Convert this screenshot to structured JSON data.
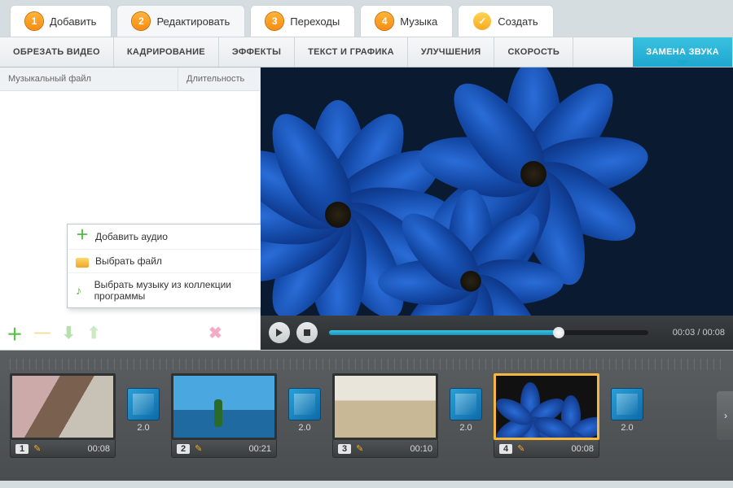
{
  "wizard": {
    "steps": [
      {
        "num": "1",
        "label": "Добавить"
      },
      {
        "num": "2",
        "label": "Редактировать"
      },
      {
        "num": "3",
        "label": "Переходы"
      },
      {
        "num": "4",
        "label": "Музыка"
      },
      {
        "num": "✓",
        "label": "Создать"
      }
    ],
    "active_index": 1
  },
  "subtabs": {
    "items": [
      "ОБРЕЗАТЬ ВИДЕО",
      "КАДРИРОВАНИЕ",
      "ЭФФЕКТЫ",
      "ТЕКСТ И ГРАФИКА",
      "УЛУЧШЕНИЯ",
      "СКОРОСТЬ",
      "ЗАМЕНА ЗВУКА"
    ],
    "active_index": 6
  },
  "left_panel": {
    "col_file": "Музыкальный файл",
    "col_duration": "Длительность"
  },
  "dropdown": {
    "header": "Добавить аудио",
    "opt_file": "Выбрать файл",
    "opt_library": "Выбрать музыку из коллекции программы"
  },
  "player": {
    "current": "00:03",
    "sep": " / ",
    "total": "00:08",
    "progress_pct": 72
  },
  "timeline": {
    "clips": [
      {
        "idx": "1",
        "dur": "00:08",
        "trans": "2.0"
      },
      {
        "idx": "2",
        "dur": "00:21",
        "trans": "2.0"
      },
      {
        "idx": "3",
        "dur": "00:10",
        "trans": "2.0"
      },
      {
        "idx": "4",
        "dur": "00:08",
        "trans": "2.0",
        "selected": true
      }
    ]
  },
  "colors": {
    "accent": "#1ea8d0",
    "step_orange": "#f88c11",
    "timeline_selected": "#f5b83f"
  }
}
